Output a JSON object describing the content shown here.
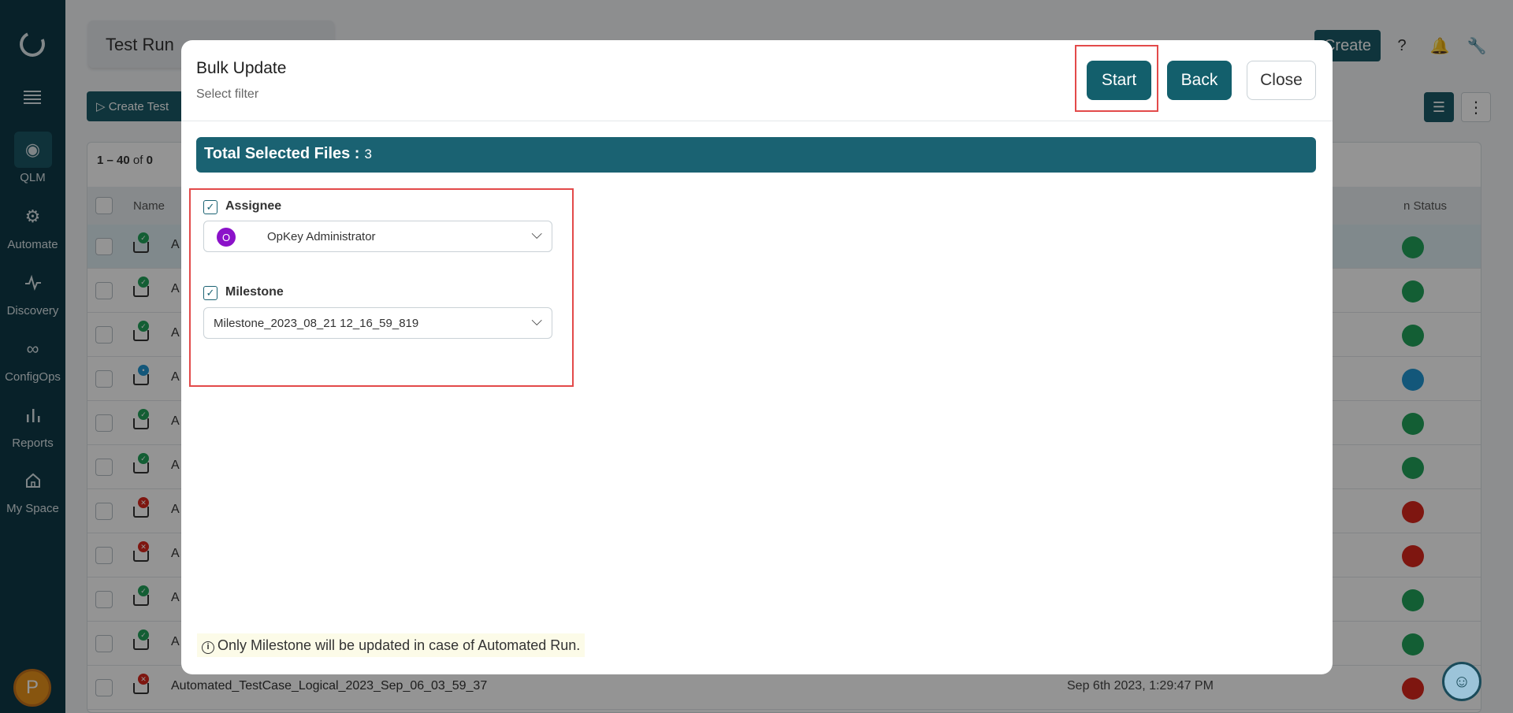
{
  "sidebar": {
    "items": [
      {
        "label": "QLM",
        "icon": "qlm-icon",
        "active": true
      },
      {
        "label": "Automate",
        "icon": "automate-icon"
      },
      {
        "label": "Discovery",
        "icon": "discovery-icon"
      },
      {
        "label": "ConfigOps",
        "icon": "configops-icon"
      },
      {
        "label": "Reports",
        "icon": "reports-icon"
      },
      {
        "label": "My Space",
        "icon": "home-icon"
      }
    ],
    "avatar_initial": "P"
  },
  "background": {
    "page_title": "Test Run",
    "create_test_label": "Create Test",
    "create_label": "Create",
    "count_range": "1 – 40",
    "count_of": "of",
    "count_total": "0",
    "col_name": "Name",
    "col_status": "n Status",
    "row_prefix": "A",
    "last_row_name": "Automated_TestCase_Logical_2023_Sep_06_03_59_37",
    "last_row_date": "Sep 6th 2023, 1:29:47 PM",
    "colors": {
      "pass": "#22a35a",
      "fail": "#d9261c",
      "running": "#2196d3"
    }
  },
  "modal": {
    "title": "Bulk Update",
    "subtitle": "Select filter",
    "start_label": "Start",
    "back_label": "Back",
    "close_label": "Close",
    "total_label": "Total Selected Files :",
    "total_value": "3",
    "assignee": {
      "label": "Assignee",
      "checked": true,
      "avatar_initial": "O",
      "value": "OpKey Administrator"
    },
    "milestone": {
      "label": "Milestone",
      "checked": true,
      "value": "Milestone_2023_08_21 12_16_59_819"
    },
    "note": "Only Milestone will be updated in case of Automated Run.",
    "colors": {
      "primary": "#135f6c",
      "highlight": "#e34a4a"
    }
  }
}
